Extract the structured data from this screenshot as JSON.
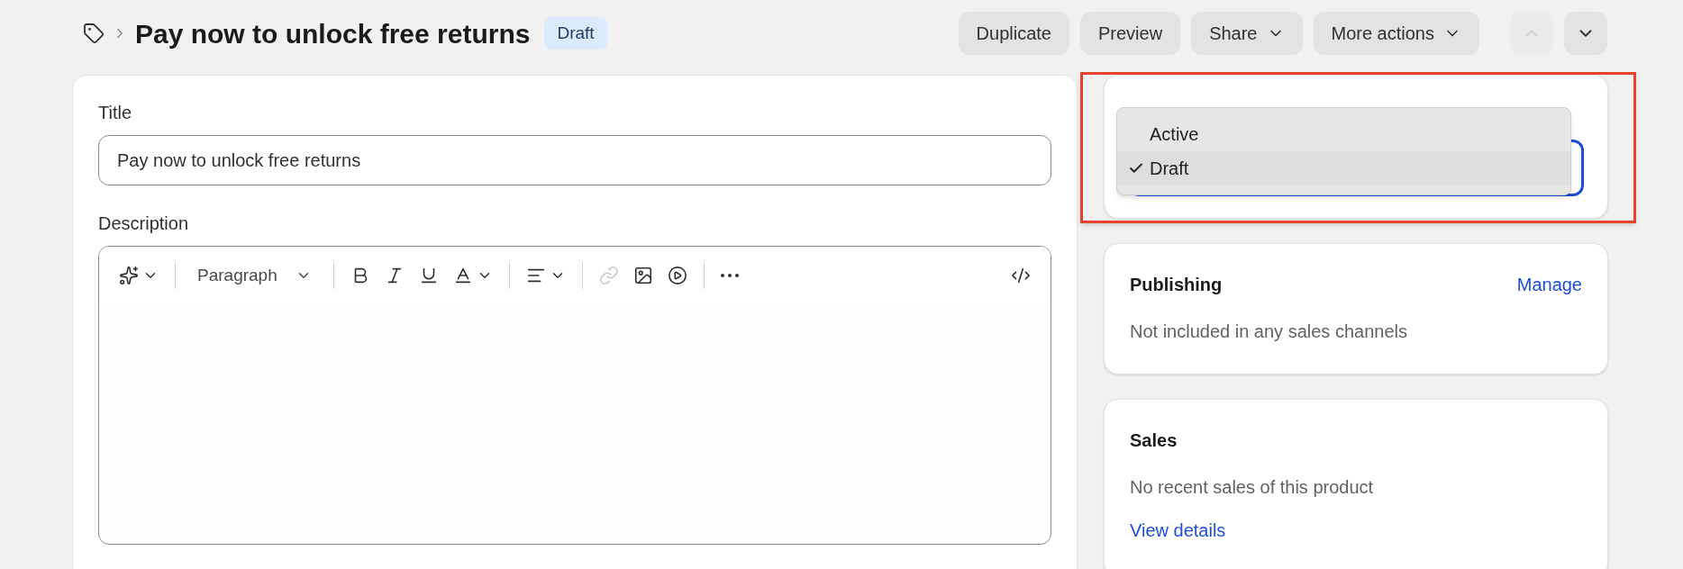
{
  "header": {
    "title": "Pay now to unlock free returns",
    "badge": "Draft",
    "actions": [
      {
        "label": "Duplicate",
        "kind": "plain"
      },
      {
        "label": "Preview",
        "kind": "plain"
      },
      {
        "label": "Share",
        "kind": "menu"
      },
      {
        "label": "More actions",
        "kind": "menu"
      }
    ],
    "navigation": [
      {
        "kind": "previous",
        "disabled": true
      },
      {
        "kind": "next",
        "disabled": false
      }
    ]
  },
  "form": {
    "title_field": {
      "label": "Title",
      "value": "Pay now to unlock free returns"
    },
    "description": {
      "label": "Description",
      "block_format": "Paragraph",
      "link_disabled": true
    }
  },
  "status": {
    "expanded": true,
    "options": [
      {
        "label": "Active",
        "selected": false
      },
      {
        "label": "Draft",
        "selected": true
      }
    ]
  },
  "publishing": {
    "title": "Publishing",
    "action": "Manage",
    "text": "Not included in any sales channels"
  },
  "sales": {
    "title": "Sales",
    "text": "No recent sales of this product",
    "link": "View details"
  }
}
